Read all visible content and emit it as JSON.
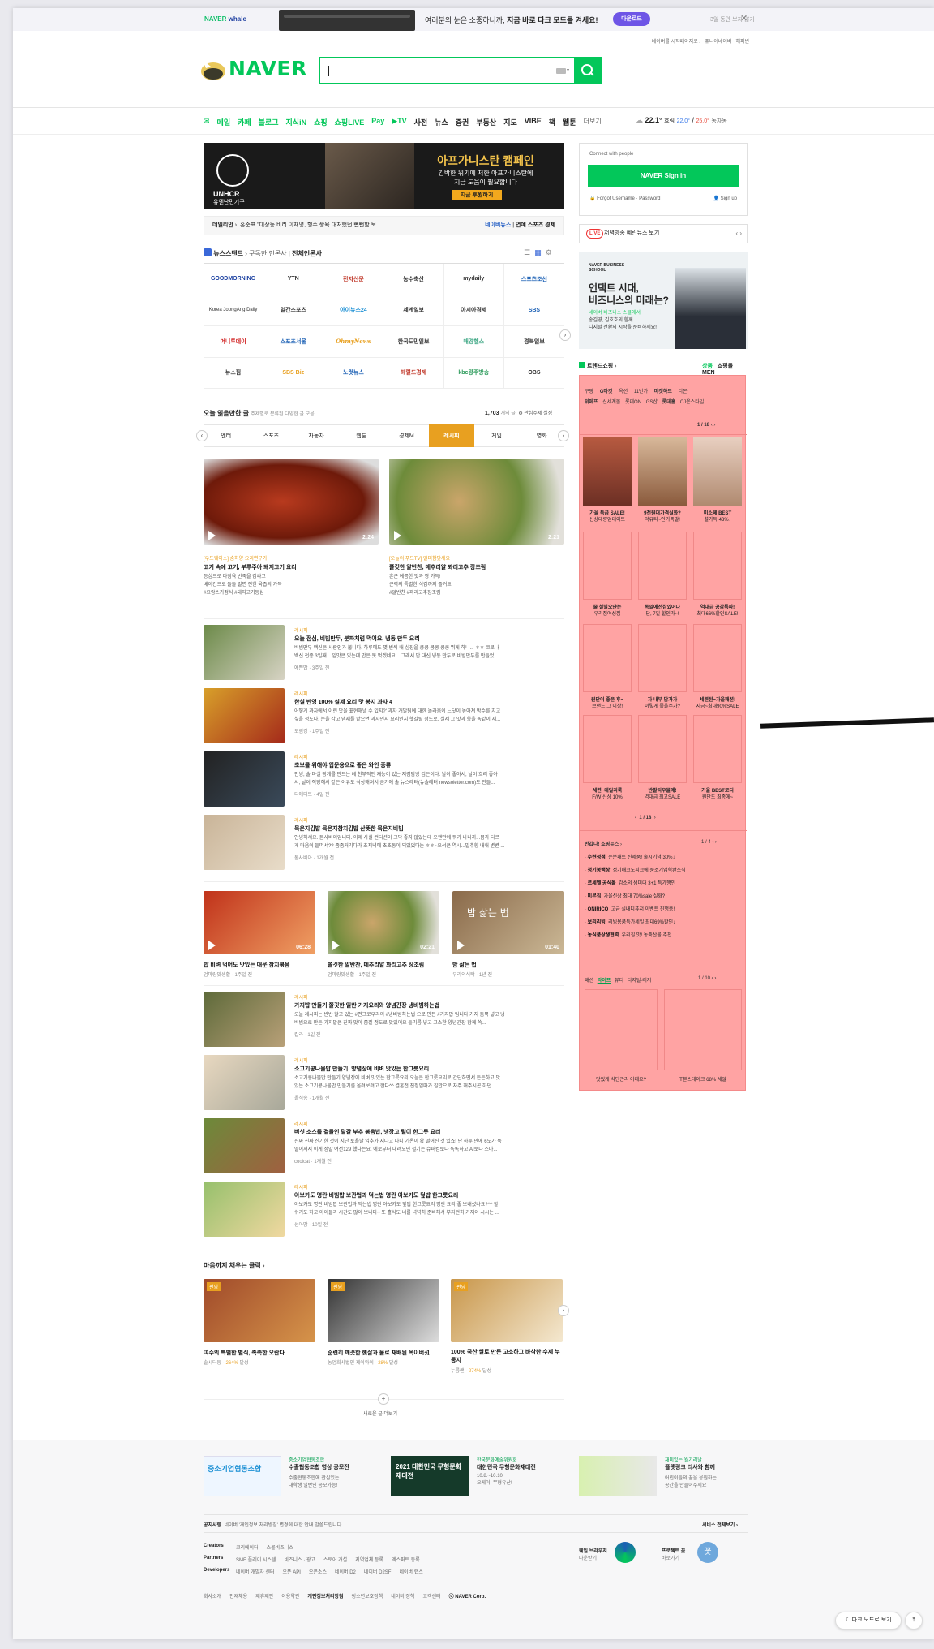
{
  "banner": {
    "brand_a": "NAVER",
    "brand_b": "whale",
    "text_plain": "여러분의 눈은 소중하니까, ",
    "text_bold": "지금 바로 다크 모드를 켜세요!",
    "button": "다운로드",
    "close_days": "3일 동안 보지 않기"
  },
  "toplinks": {
    "home": "네이버를 시작페이지로",
    "a": "쥬니어네이버",
    "b": "해피빈"
  },
  "logo": "NAVER",
  "search": {
    "placeholder": ""
  },
  "nav": [
    "메일",
    "카페",
    "블로그",
    "지식iN",
    "쇼핑",
    "쇼핑LIVE",
    "Pay",
    "▶TV",
    "사전",
    "뉴스",
    "증권",
    "부동산",
    "지도",
    "VIBE",
    "책",
    "웹툰",
    "더보기"
  ],
  "weather": {
    "temp": "22.1°",
    "state": "흐림",
    "low": "22.0°",
    "high": "25.0°",
    "place": "동자동"
  },
  "unhcr": {
    "org": "UNHCR",
    "org_kr": "유엔난민기구",
    "title": "아프가니스탄 캠페인",
    "line1": "긴박한 위기에 처한 아프가니스탄에",
    "line2": "지금 도움이 필요합니다",
    "button": "지금 후원하기"
  },
  "newsbar": {
    "tag": "데일리안",
    "headline": "홍준표 \"대장동 비리 이재명, 형수 쌍욕 대처했던 뻔뻔함 보...",
    "tabs": [
      "네이버뉴스",
      "연예",
      "스포츠",
      "경제"
    ]
  },
  "newsstand": {
    "title": "뉴스스탠드",
    "sub": "구독한 언론사",
    "all": "전체언론사",
    "outlets": [
      "GOODMORNING",
      "YTN",
      "전자신문",
      "농수축산",
      "mydaily",
      "스포츠조선",
      "Korea JoongAng Daily",
      "일간스포츠",
      "아이뉴스24",
      "세계일보",
      "아시아경제",
      "SBS",
      "머니투데이",
      "스포츠서울",
      "OhmyNews",
      "한국도민일보",
      "매경헬스",
      "경북일보",
      "뉴스핌",
      "SBS Biz",
      "노컷뉴스",
      "헤럴드경제",
      "kbc광주방송",
      "OBS"
    ]
  },
  "recommend": {
    "title": "오늘 읽을만한 글",
    "sub": "주제별로 분류된 다양한 글 모음",
    "count": "1,703",
    "count_unit": "개의 글",
    "setting": "관심주제 설정",
    "chips": [
      "엔터",
      "스포츠",
      "자동차",
      "웹툰",
      "경제M",
      "레시피",
      "게임",
      "영화"
    ]
  },
  "videos": [
    {
      "cat": "[우드웨이스] 숨하양 요리연구가",
      "title": "고기 속에 고기, 부루주아 돼지고기 요리",
      "d1": "등심으로 다짐육 반죽을 감싸고",
      "d2": "베이컨으로 돌돌 말면 진한 육즙의 가득",
      "tags": "#요람스가정식 #돼지고기등심",
      "dur": "2:24"
    },
    {
      "cat": "[오늘의 푸드TV] 얼미참맞세요",
      "title": "쫄깃한 알반찬, 메추리알 꽈리고추 장조림",
      "d1": "흔근 예쁨한 맛과 짱 가득!",
      "d2": "근력의 특별한 식감까지 즐거요",
      "tags": "#알반찬 #꽈리고추장조림",
      "dur": "2:21"
    }
  ],
  "articles": [
    {
      "cat": "레시피",
      "title": "오늘 점심, 비빔만두, 분짜처럼 먹어요, 냉동 만두 요리",
      "d1": "비빔만두 백신은 사람인가 봅니다. 하루에도 몇 번씩 내 심장을 쿵쿵 쿵쿵 쿵쿵 뛰게 하니... ㅎㅎ 코로나",
      "d2": "백신 접종 3일째... 입맛은 있는데 밥은 못 먹겠네요... 그래서 밥 대신 냉동 만두로 비빔만두를 만들었...",
      "meta": "예쁜밥 · 3주일 전"
    },
    {
      "cat": "레시피",
      "title": "한실 반영 100% 실제 요리 맛 봉지 과자 4",
      "d1": "어떻게 과자에서 이런 맛을 표현해낼 수 있지?' 과자 개발팀에 대한 놀라움이 느닷이 높아져 박수를 치고",
      "d2": "싶을 정도다. 눈을 감고 냄새를 맡으면 과자인지 요리인지 헷갈릴 정도로, 실제 그 맛과 향을 똑같이 재...",
      "meta": "도림킹 · 1주일 전"
    },
    {
      "cat": "레시피",
      "title": "초보를 위해야 입문용으로 좋은 와인 종류",
      "d1": "안녕, 술 마실 핑계를 만드는 데 천부적인 재능이 있는 저렴탐방 김은이다. 날이 좋아서, 날이 흐리 좋아",
      "d2": "서, 날이 적당해서 같은 이유도 식상해져서 금기에 술 뉴스레터(뉴슬레터 newsoletter.com)도 만들...",
      "meta": "디에디트 · 4일 전"
    },
    {
      "cat": "레시피",
      "title": "묵은지김밥 묵은지참치김밥 산뜻한 묵은지비빔",
      "d1": "안녕하세요. 봄사비이입니다. 어제 사실 컨디션이 그닥 좋지 않았는데 오랜만에 뭐가 나니까...몸과 다르",
      "d2": "게 마음이 들떠서?? 좀좀거리다가 초저녁에 초초동이 되었었다는 ㅎㅎ~오석은 역시...밀추향 내내 변변 ...",
      "meta": "봄사비아 · 1개월 전"
    }
  ],
  "videos3": [
    {
      "title": "밥 비벼 먹어도 맛있는 매운 참치볶음",
      "meta": "엄마랑맛생활 · 1주일 전",
      "dur": "06:28"
    },
    {
      "title": "쫄깃한 알반찬, 메추리알 꽈리고추 장조림",
      "meta": "엄마랑맛생활 · 1주일 전",
      "dur": "02:21"
    },
    {
      "title": "밤 삶는 법",
      "meta": "우리의식탁 · 1년 전",
      "dur": "01:40",
      "overlay": "밤 삶는 법"
    }
  ],
  "articles2": [
    {
      "cat": "레시피",
      "title": "가지밥 만들기 쫄깃한 일반 가지요리와 양념간장 냉비빔하는법",
      "d1": "오늘 레시피는 반반 할고 있는 #편그로우리의 #냉비빔하는법 으로 만든 #가지밥 입니다 가지 듬뿍 넣고 냉",
      "d2": "비빔으로 만든 가지밥은 진짜 맛이 쫌질 정도로 맛있어요 들기름 넣고 고소한 양념간장 함께 쓱...",
      "meta": "칼라 · 1일 전"
    },
    {
      "cat": "레시피",
      "title": "소고기콩나물밥 만들기, 양념장에 비벼 맛있는 한그릇요리",
      "d1": "소고기콩나물밥 만들기 양념장에 비벼 맛있는 한그릇요리 오늘은 한그릇요리로 간단하면서 든든하고 맛",
      "d2": "있는 소고기콩나물밥 만들기를 올려보려고 한다^^ 결혼전 친정엄마가 집밥으로 자주 해주시곤 하던 ...",
      "meta": "올식송 · 1개월 전"
    },
    {
      "cat": "레시피",
      "title": "버섯 소스를 곁들인 달걀 부추 볶음밥, 냉장고 털이 한그릇 요리",
      "d1": "진짜 진짜 신기한 것이 지난 토욜날 입추가 지나고 나니 기온이 확 떨어진 것 있죠! 단 하루 만에 6도가 뚝",
      "d2": "떨어져서 이게 정말 여선129 했다는요. 예로부터 내려오던 절기는 슈퍼컴보다 똑똑하고 AI보다 스마...",
      "meta": "coolcat · 1개월 전"
    },
    {
      "cat": "레시피",
      "title": "아보카도 명란 비빔밥 보관법과 먹는법 명란 아보카도 덮밥 한그릇요리",
      "d1": "아보카도 명란 비빔밥 보관법과 먹는법 명란 아보카도 덮밥 한그릇요리 명란 요리 좋 보내셨나요?^^ 할",
      "d2": "쉬기도 하고 아이들과 시간도 많이 보내다~ 또 흘식도 너를 넉넉히 준비해서 부지런히 가져이 시시는 ...",
      "meta": "선아맘 · 10일 전"
    }
  ],
  "funding": {
    "title": "마음까지 채우는 클릭",
    "badge": "펀딩",
    "items": [
      {
        "title": "여수의 특별한 별식, 촉촉한 오란다",
        "org": "솔시터둥",
        "rate": "264%",
        "done": "달성"
      },
      {
        "title": "순련히 깨끗한 햇살과 물로 재배된 목이버섯",
        "org": "농업회사법인 제이와이",
        "rate": "28%",
        "done": "달성"
      },
      {
        "title": "100% 국산 쌀로 만든 고소하고 바삭한 수제 누룽지",
        "org": "누룽쌘",
        "rate": "274%",
        "done": "달성"
      }
    ],
    "more": "새로운 글 더보기"
  },
  "login": {
    "connect": "Connect with people",
    "button": "NAVER Sign in",
    "forgot": "Forgot Username",
    "password": "Password",
    "signup": "Sign up"
  },
  "live": {
    "badge": "LIVE",
    "text": "저녁방송 예린뉴스 보기"
  },
  "bizad": {
    "brand": "NAVER BUSINESS SCHOOL",
    "h1": "언택트 시대,",
    "h2": "비즈니스의 미래는?",
    "s1": "네이버 비즈니스 스쿨에서",
    "s2": "송길영, 김호호의 함께",
    "s3": "디지털 전환의 시작을 준비하세요!"
  },
  "shopping": {
    "title": "트렌드쇼핑",
    "tabs": [
      "상품",
      "쇼핑몰",
      "MEN"
    ],
    "keywords1": [
      "쿠팡",
      "G마켓",
      "옥션",
      "11번가",
      "마켓하트",
      "티몬"
    ],
    "keywords2": [
      "위메프",
      "신세계몰",
      "롯데ON",
      "GS샵",
      "롯데홈",
      "CJ온스타일"
    ],
    "page": "1 / 18",
    "products": [
      [
        "가을 특급 SALE!",
        "신상대량업데이트"
      ],
      [
        "9천원대가격실화?",
        "악유타~인기폭발!"
      ],
      [
        "미소페 BEST",
        "설가득 43%↓"
      ],
      [
        "줄 설빌오얀는",
        "우리집여성집"
      ],
      [
        "독일에선집있어다",
        "단, 7일 할인가~!"
      ],
      [
        "역대급 공감특파!",
        "최대66%할인SALE!"
      ],
      [
        "원단이 좋은 후~",
        "브랜드 그 이상!"
      ],
      [
        "자 내부 맘가가",
        "이렇게 좋을수가?"
      ],
      [
        "세련된~가을패션!",
        "지금~최대90%SALE"
      ],
      [
        "세련~데일리룩",
        "F/W 신상 10%"
      ],
      [
        "반팔티우물레!",
        "역대급 최고SALE"
      ],
      [
        "가을 BEST코디",
        "원단도 최종에~"
      ]
    ],
    "deals_title": "반값다! 쇼핑뉴스",
    "deals_page": "1 / 4",
    "deals": [
      {
        "brand": "수련성점",
        "text": "은분패트 신제품! 출시기념 30%↓"
      },
      {
        "brand": "정기봉백상",
        "text": "정기매크노피크에 중소기업혁완소식"
      },
      {
        "brand": "르세벨 공식몰",
        "text": "감소의 샘미대 3+1 특가행인"
      },
      {
        "brand": "미본집",
        "text": "가을신상 최대 70%sale 실화?"
      },
      {
        "brand": "ONIRICO",
        "text": "고급 실내디퓨저 이벤트 진행중!"
      },
      {
        "brand": "보리리빙",
        "text": "리빙용품특가세일 최대69%할인↓"
      },
      {
        "brand": "농식품상생협력",
        "text": "우리집 맛! 농축산물 추천"
      }
    ],
    "cats": [
      "패션",
      "라이프",
      "뷰티",
      "디지털·레저"
    ],
    "cats_page": "1 / 10",
    "bottom": [
      "맛있게 식단관리 어때요?",
      "T본스테이크 68% 세일"
    ]
  },
  "footer": {
    "ads": [
      {
        "title": "중소기업협동조합",
        "sub": "수출협동조합 영상 공모전",
        "d1": "수출협동조합에 관심있는",
        "d2": "대학생 일반인 공모가능!",
        "tag": "중소기업협동",
        "img": "중소기업협동조합"
      },
      {
        "title": "한국문화예술위원회",
        "sub": "대한민국 무형문화재대전",
        "d1": "10.8.~10.10.",
        "d2": "오케이! 무형유산!",
        "tag": "2021 대한민국 무형문화재대전",
        "img": "2021 대한민국 무형문화재대전"
      },
      {
        "title": "재미있는 월기리날",
        "sub": "플랫링크 리사와 함께",
        "d1": "어린이들의 꿈을 응원하는",
        "d2": "공간을 만들어주세요",
        "tag": "",
        "img": ""
      }
    ],
    "notice_label": "공지사항",
    "notice": "네이버 '개인정보 처리방침' 변경에 대한 안내 말씀드립니다.",
    "service_all": "서비스 전체보기",
    "rows": [
      {
        "label": "Creators",
        "items": [
          "크리에이터",
          "스몰비즈니스"
        ]
      },
      {
        "label": "Partners",
        "items": [
          "SME 플레이 시스템",
          "비즈니스 · 광고",
          "스토어 개설",
          "지역업체 등록",
          "엑스퍼트 등록"
        ]
      },
      {
        "label": "Developers",
        "items": [
          "네이버 개발자 센터",
          "오픈 API",
          "오픈소스",
          "네이버 D2",
          "네이버 D2SF",
          "네이버 랩스"
        ]
      }
    ],
    "whale": "웨일 브라우저",
    "whale_sub": "다운받기",
    "profile": "프로젝트 꽃",
    "profile_sub": "바로가기",
    "bottom": [
      "회사소개",
      "인재채용",
      "제휴제안",
      "이용약관",
      "개인정보처리방침",
      "청소년보호정책",
      "네이버 정책",
      "고객센터",
      "ⓒ NAVER Corp."
    ],
    "dark": "다크 모드로 보기"
  }
}
